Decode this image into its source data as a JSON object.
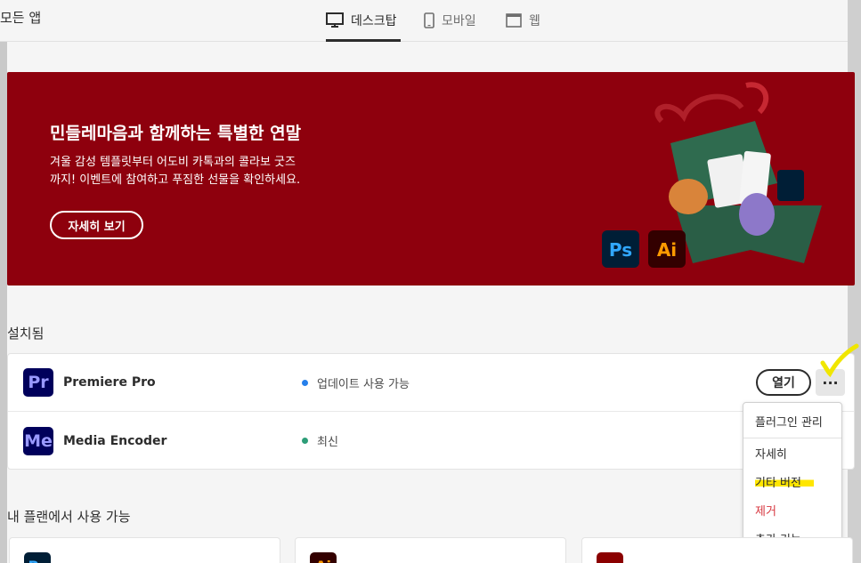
{
  "header": {
    "all_apps": "모든 앱",
    "tabs": [
      {
        "label": "데스크탑",
        "icon": "monitor-icon",
        "active": true
      },
      {
        "label": "모바일",
        "icon": "mobile-icon",
        "active": false
      },
      {
        "label": "웹",
        "icon": "browser-window-icon",
        "active": false
      }
    ]
  },
  "banner": {
    "title": "민들레마음과 함께하는 특별한 연말",
    "desc_line1": "겨울 감성 템플릿부터 어도비 카톡과의 콜라보 굿즈",
    "desc_line2": "까지! 이벤트에 참여하고 푸짐한 선물을 확인하세요.",
    "button": "자세히 보기",
    "art_badges": [
      "Ps",
      "Ai"
    ],
    "background_color": "#8e000d"
  },
  "installed": {
    "label": "설치됨",
    "apps": [
      {
        "abbr": "Pr",
        "name": "Premiere Pro",
        "status": "업데이트 사용 가능",
        "status_color": "#2680eb",
        "icon_bg": "#00005b",
        "icon_fg": "#9999ff",
        "open_label": "열기",
        "more_label": "···"
      },
      {
        "abbr": "Me",
        "name": "Media Encoder",
        "status": "최신",
        "status_color": "#2d9d78",
        "icon_bg": "#00005b",
        "icon_fg": "#9999ff"
      }
    ]
  },
  "context_menu": {
    "items": [
      {
        "label": "플러그인 관리"
      },
      {
        "label": "자세히"
      },
      {
        "label": "기타 버전",
        "highlighted": true
      },
      {
        "label": "제거",
        "danger": true
      },
      {
        "label": "추가 기능"
      }
    ]
  },
  "available": {
    "label": "내 플랜에서 사용 가능",
    "apps": [
      {
        "abbr": "Ps",
        "icon_bg": "#001e36",
        "icon_fg": "#31a8ff"
      },
      {
        "abbr": "Ai",
        "icon_bg": "#330000",
        "icon_fg": "#ff9a00"
      },
      {
        "abbr": "",
        "icon_bg": "#8b0000",
        "icon_fg": "#ffffff"
      }
    ]
  }
}
